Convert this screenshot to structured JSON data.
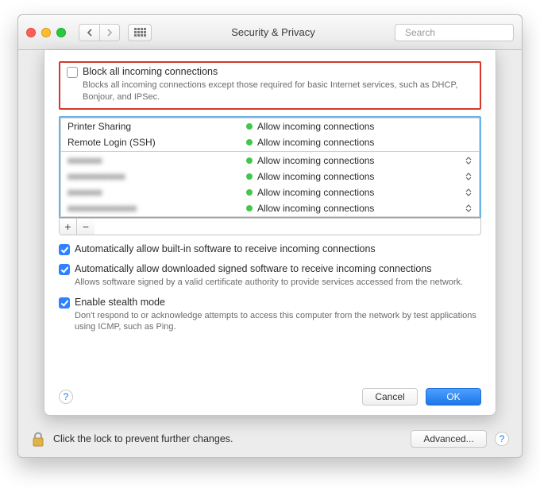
{
  "window": {
    "title": "Security & Privacy",
    "search_placeholder": "Search"
  },
  "sheet": {
    "block_all": {
      "checked": false,
      "label": "Block all incoming connections",
      "description": "Blocks all incoming connections except those required for basic Internet services, such as DHCP, Bonjour, and IPSec."
    },
    "allow_text": "Allow incoming connections",
    "list": {
      "top": [
        {
          "name": "Printer Sharing"
        },
        {
          "name": "Remote Login (SSH)"
        }
      ],
      "apps": [
        {
          "name": "■■■■■■"
        },
        {
          "name": "■■■■■■■■■■"
        },
        {
          "name": "■■■■■■"
        },
        {
          "name": "■■■■■■■■■■■■"
        }
      ]
    },
    "add_label": "+",
    "remove_label": "−",
    "auto_builtin": {
      "checked": true,
      "label": "Automatically allow built-in software to receive incoming connections"
    },
    "auto_signed": {
      "checked": true,
      "label": "Automatically allow downloaded signed software to receive incoming connections",
      "description": "Allows software signed by a valid certificate authority to provide services accessed from the network."
    },
    "stealth": {
      "checked": true,
      "label": "Enable stealth mode",
      "description": "Don't respond to or acknowledge attempts to access this computer from the network by test applications using ICMP, such as Ping."
    },
    "cancel": "Cancel",
    "ok": "OK",
    "help": "?"
  },
  "footer": {
    "lock_text": "Click the lock to prevent further changes.",
    "advanced": "Advanced...",
    "help": "?"
  }
}
